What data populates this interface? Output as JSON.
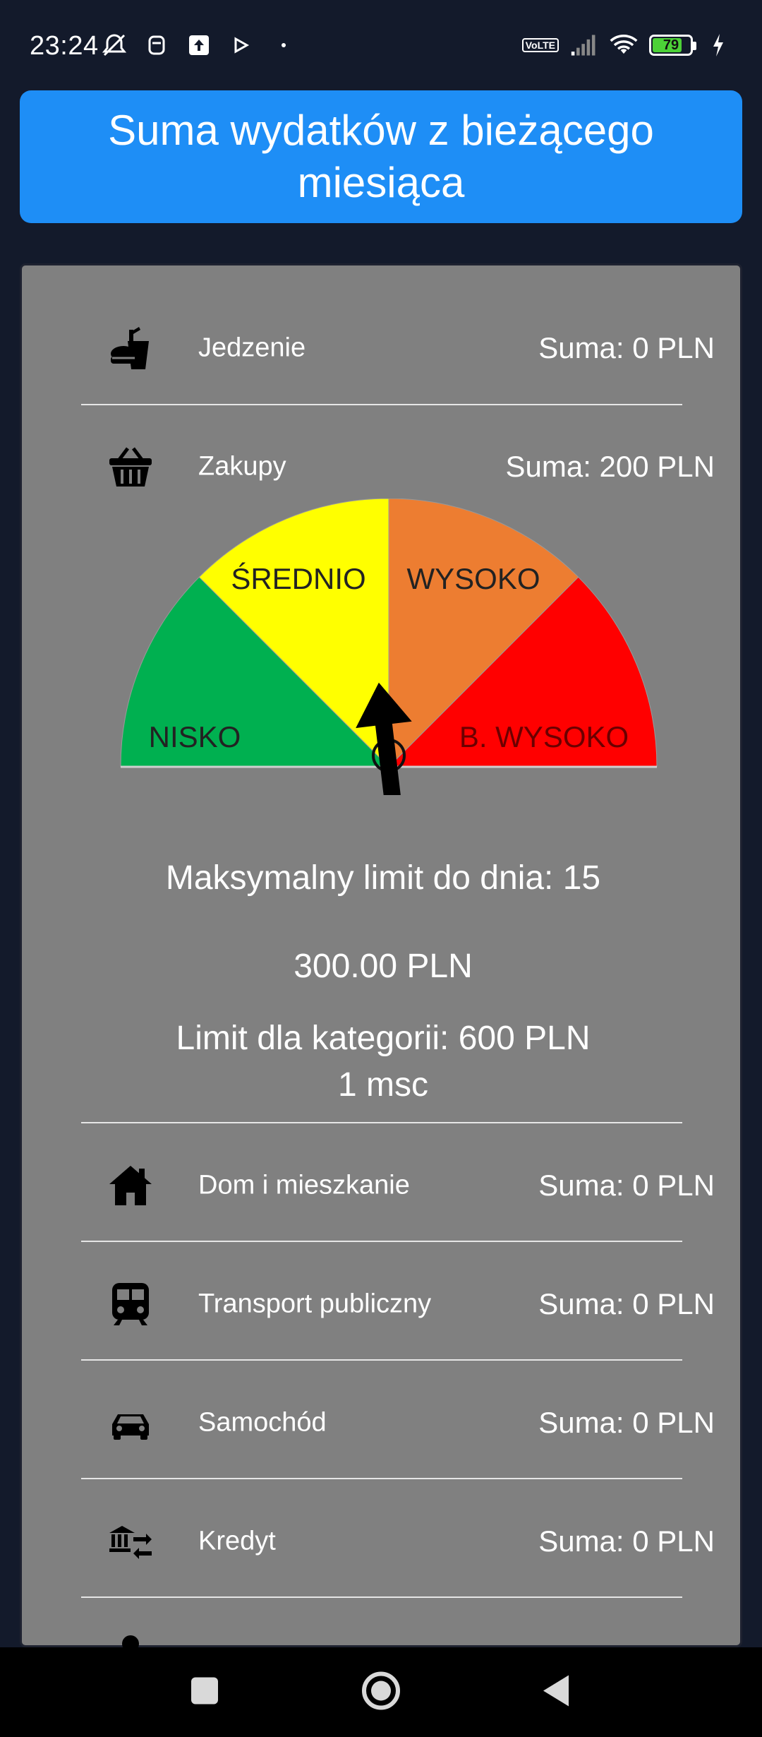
{
  "status_bar": {
    "time": "23:24",
    "left_icons": [
      "alarm-off-icon",
      "notification-icon",
      "upload-icon",
      "play-icon",
      "dot-icon"
    ],
    "volte": "VoLTE",
    "battery_level": "79",
    "battery_fraction": 0.79
  },
  "header": {
    "title": "Suma wydatków z bieżącego miesiąca"
  },
  "categories": [
    {
      "label": "Jedzenie",
      "sum": "Suma: 0 PLN",
      "icon": "food-icon"
    },
    {
      "label": "Zakupy",
      "sum": "Suma: 200 PLN",
      "icon": "basket-icon"
    },
    {
      "label": "Dom i mieszkanie",
      "sum": "Suma: 0 PLN",
      "icon": "house-icon"
    },
    {
      "label": "Transport publiczny",
      "sum": "Suma: 0 PLN",
      "icon": "train-icon"
    },
    {
      "label": "Samochód",
      "sum": "Suma: 0 PLN",
      "icon": "car-icon"
    },
    {
      "label": "Kredyt",
      "sum": "Suma: 0 PLN",
      "icon": "bank-transfer-icon"
    }
  ],
  "gauge": {
    "segments": [
      {
        "label": "NISKO",
        "color": "#00b050"
      },
      {
        "label": "ŚREDNIO",
        "color": "#ffff00"
      },
      {
        "label": "WYSOKO",
        "color": "#ed7d31"
      },
      {
        "label": "B. WYSOKO",
        "color": "#ff0000"
      }
    ],
    "needle_level": "ŚREDNIO"
  },
  "limits": {
    "max_limit_text": "Maksymalny limit do dnia: 15",
    "amount": "300.00 PLN",
    "category_limit": "Limit dla kategorii: 600 PLN",
    "period": "1 msc"
  },
  "colors": {
    "background": "#131a2b",
    "header": "#1e8ef6",
    "card": "#808080"
  }
}
